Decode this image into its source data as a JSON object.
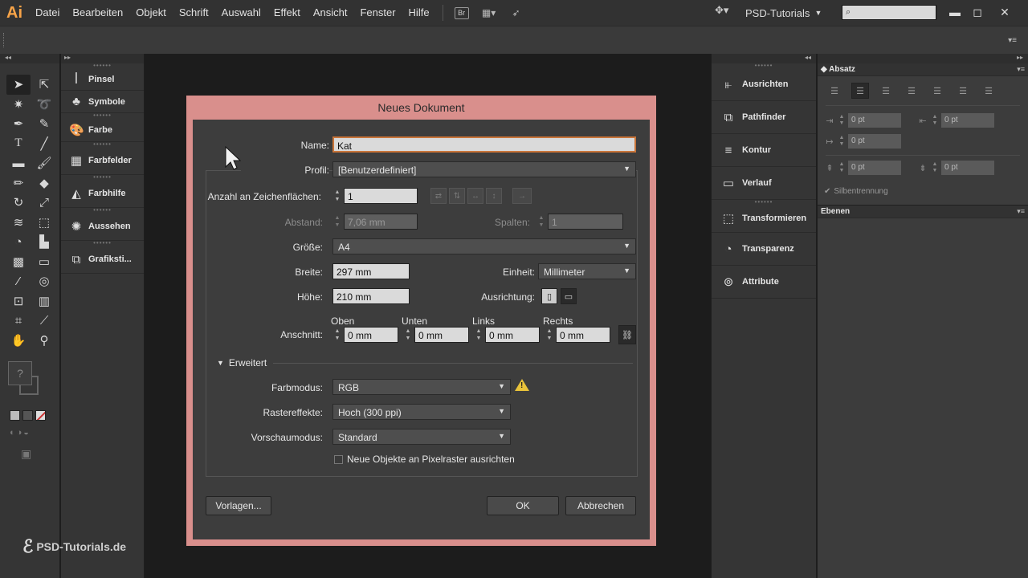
{
  "app": {
    "logo": "Ai"
  },
  "menu": [
    "Datei",
    "Bearbeiten",
    "Objekt",
    "Schrift",
    "Auswahl",
    "Effekt",
    "Ansicht",
    "Fenster",
    "Hilfe"
  ],
  "bridge": "Br",
  "workspace": "PSD-Tutorials",
  "left_panel": [
    {
      "label": "Pinsel",
      "icon": "brush-icon"
    },
    {
      "label": "Symbole",
      "icon": "club-icon"
    },
    {
      "label": "Farbe",
      "icon": "palette-icon"
    },
    {
      "label": "Farbfelder",
      "icon": "swatches-icon"
    },
    {
      "label": "Farbhilfe",
      "icon": "color-guide-icon"
    },
    {
      "label": "Aussehen",
      "icon": "appearance-icon"
    },
    {
      "label": "Grafiksti...",
      "icon": "graphic-styles-icon"
    }
  ],
  "right_panel": [
    {
      "label": "Ausrichten",
      "icon": "align-icon"
    },
    {
      "label": "Pathfinder",
      "icon": "pathfinder-icon"
    },
    {
      "label": "Kontur",
      "icon": "stroke-icon"
    },
    {
      "label": "Verlauf",
      "icon": "gradient-icon"
    },
    {
      "label": "Transformieren",
      "icon": "transform-icon"
    },
    {
      "label": "Transparenz",
      "icon": "transparency-icon"
    },
    {
      "label": "Attribute",
      "icon": "attributes-icon"
    }
  ],
  "absatz": {
    "title": "Absatz",
    "fields": [
      "0 pt",
      "0 pt",
      "0 pt",
      "0 pt",
      "0 pt"
    ],
    "hyphenation": "Silbentrennung"
  },
  "ebenen": {
    "title": "Ebenen"
  },
  "dialog": {
    "title": "Neues Dokument",
    "name_label": "Name:",
    "name_value": "Kat",
    "profile_label": "Profil:",
    "profile_value": "[Benutzerdefiniert]",
    "artboards_label": "Anzahl an Zeichenflächen:",
    "artboards_value": "1",
    "spacing_label": "Abstand:",
    "spacing_value": "7,06 mm",
    "columns_label": "Spalten:",
    "columns_value": "1",
    "size_label": "Größe:",
    "size_value": "A4",
    "width_label": "Breite:",
    "width_value": "297 mm",
    "unit_label": "Einheit:",
    "unit_value": "Millimeter",
    "height_label": "Höhe:",
    "height_value": "210 mm",
    "orientation_label": "Ausrichtung:",
    "bleed_label": "Anschnitt:",
    "bleed": [
      {
        "label": "Oben",
        "value": "0 mm"
      },
      {
        "label": "Unten",
        "value": "0 mm"
      },
      {
        "label": "Links",
        "value": "0 mm"
      },
      {
        "label": "Rechts",
        "value": "0 mm"
      }
    ],
    "advanced_label": "Erweitert",
    "colormode_label": "Farbmodus:",
    "colormode_value": "RGB",
    "raster_label": "Rastereffekte:",
    "raster_value": "Hoch (300 ppi)",
    "preview_label": "Vorschaumodus:",
    "preview_value": "Standard",
    "pixelgrid_label": "Neue Objekte an Pixelraster ausrichten",
    "templates_button": "Vorlagen...",
    "ok_button": "OK",
    "cancel_button": "Abbrechen"
  },
  "watermark": "PSD-Tutorials.de",
  "colors": {
    "accent_frame": "#d98f8c",
    "dialog_bg": "#3d3d3d",
    "warning": "#e8c23a",
    "logo": "#f8a448"
  }
}
